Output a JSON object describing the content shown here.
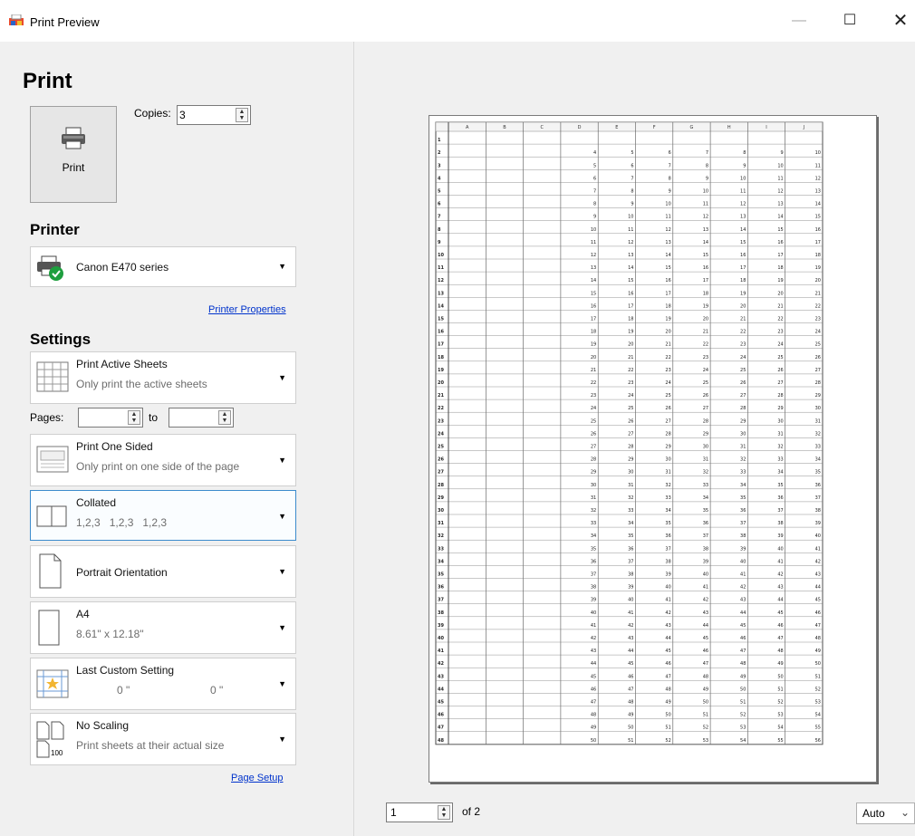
{
  "window": {
    "title": "Print Preview",
    "minimize": "—",
    "maximize": "☐",
    "close": "✕"
  },
  "print": {
    "heading": "Print",
    "button_label": "Print",
    "copies_label": "Copies:",
    "copies_value": "3"
  },
  "printer": {
    "heading": "Printer",
    "name": "Canon E470 series",
    "properties_link": "Printer Properties"
  },
  "settings": {
    "heading": "Settings",
    "what": {
      "title": "Print Active Sheets",
      "subtitle": "Only print the active sheets"
    },
    "pages_label": "Pages:",
    "pages_from": "",
    "pages_to_label": "to",
    "pages_to": "",
    "sides": {
      "title": "Print One Sided",
      "subtitle": "Only print on one side of the page"
    },
    "collation": {
      "title": "Collated",
      "subtitle": "1,2,3   1,2,3   1,2,3"
    },
    "orientation": {
      "title": "Portrait Orientation"
    },
    "paper": {
      "title": "A4",
      "subtitle": "8.61\" x 12.18\""
    },
    "margins": {
      "title": "Last Custom Setting",
      "left_value": "0 \"",
      "right_value": "0 \""
    },
    "scaling": {
      "title": "No Scaling",
      "subtitle": "Print sheets at their actual size",
      "icon_text": "100"
    },
    "page_setup_link": "Page Setup"
  },
  "preview": {
    "columns": [
      "A",
      "B",
      "C",
      "D",
      "E",
      "F",
      "G",
      "H",
      "I",
      "J"
    ],
    "row_count": 48,
    "data_start_row": 2,
    "data_columns": [
      "D",
      "E",
      "F",
      "G",
      "H",
      "I",
      "J"
    ],
    "first_value": 4,
    "page_number": "1",
    "of_label": "of 2",
    "zoom": "Auto"
  }
}
